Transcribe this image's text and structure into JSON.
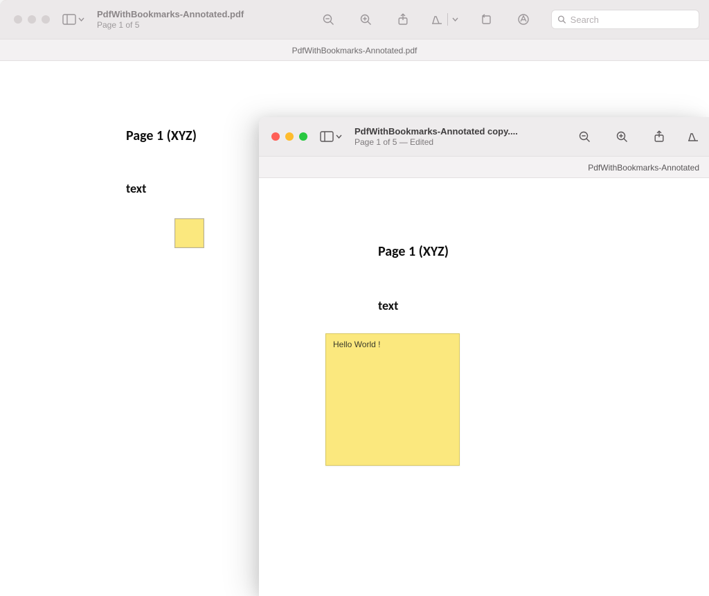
{
  "window1": {
    "title": "PdfWithBookmarks-Annotated.pdf",
    "subtitle": "Page 1 of 5",
    "tab_label": "PdfWithBookmarks-Annotated.pdf",
    "search_placeholder": "Search",
    "document": {
      "heading": "Page 1 (XYZ)",
      "body": "text"
    }
  },
  "window2": {
    "title": "PdfWithBookmarks-Annotated copy....",
    "subtitle": "Page 1 of 5 — Edited",
    "tab_label": "PdfWithBookmarks-Annotated",
    "document": {
      "heading": "Page 1 (XYZ)",
      "body": "text",
      "sticky_text": "Hello World !"
    }
  },
  "colors": {
    "sticky": "#fbe87e"
  }
}
